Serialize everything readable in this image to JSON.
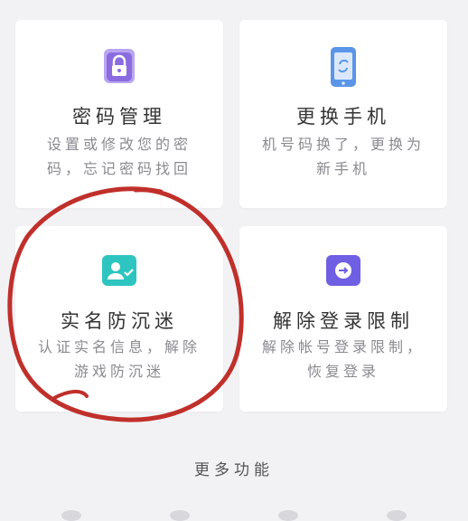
{
  "cards": [
    {
      "title": "密码管理",
      "desc": "设置或修改您的密码，忘记密码找回",
      "icon": "lock-icon"
    },
    {
      "title": "更换手机",
      "desc": "机号码换了，更换为新手机",
      "icon": "phone-icon"
    },
    {
      "title": "实名防沉迷",
      "desc": "认证实名信息，解除游戏防沉迷",
      "icon": "id-card-icon"
    },
    {
      "title": "解除登录限制",
      "desc": "解除帐号登录限制，恢复登录",
      "icon": "arrow-circle-icon"
    }
  ],
  "more_label": "更多功能",
  "colors": {
    "lock": "#8b6ce0",
    "phone": "#5b95e8",
    "idcard": "#2ec5c0",
    "unlock": "#6f5fe3",
    "annotation": "#c0302b"
  }
}
